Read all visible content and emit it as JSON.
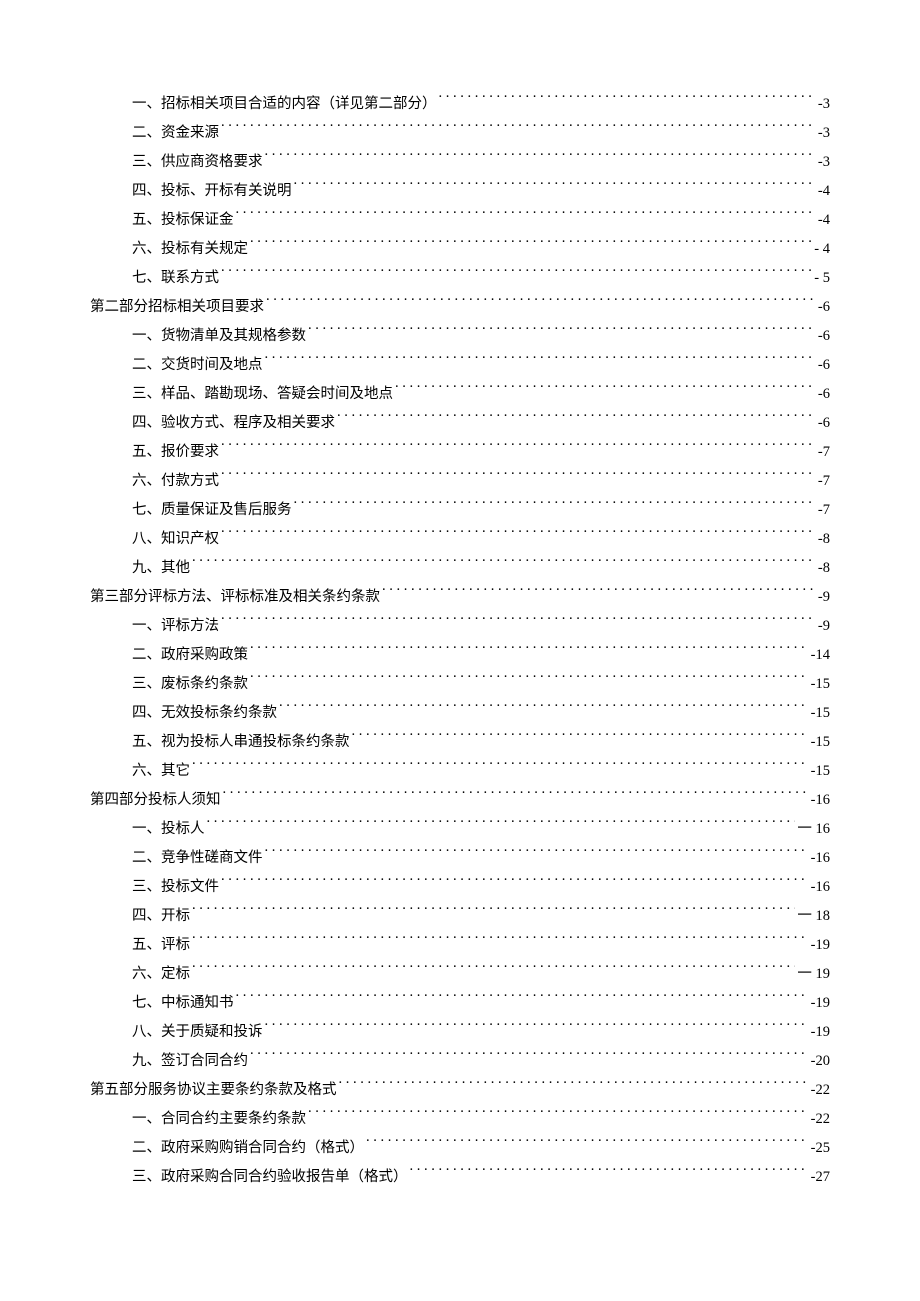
{
  "toc": [
    {
      "level": 2,
      "label": "一、招标相关项目合适的内容（详见第二部分）",
      "page": "-3"
    },
    {
      "level": 2,
      "label": "二、资金来源",
      "page": "-3"
    },
    {
      "level": 2,
      "label": "三、供应商资格要求",
      "page": "-3"
    },
    {
      "level": 2,
      "label": "四、投标、开标有关说明",
      "page": "-4"
    },
    {
      "level": 2,
      "label": "五、投标保证金",
      "page": "-4"
    },
    {
      "level": 2,
      "label": "六、投标有关规定",
      "page": "- 4"
    },
    {
      "level": 2,
      "label": "七、联系方式",
      "page": "- 5"
    },
    {
      "level": 1,
      "label": "第二部分招标相关项目要求",
      "page": "-6"
    },
    {
      "level": 2,
      "label": "一、货物清单及其规格参数",
      "page": "-6"
    },
    {
      "level": 2,
      "label": "二、交货时间及地点",
      "page": "-6"
    },
    {
      "level": 2,
      "label": "三、样品、踏勘现场、答疑会时间及地点",
      "page": "-6"
    },
    {
      "level": 2,
      "label": "四、验收方式、程序及相关要求",
      "page": "-6"
    },
    {
      "level": 2,
      "label": "五、报价要求",
      "page": "-7"
    },
    {
      "level": 2,
      "label": "六、付款方式",
      "page": "-7"
    },
    {
      "level": 2,
      "label": "七、质量保证及售后服务",
      "page": "-7"
    },
    {
      "level": 2,
      "label": "八、知识产权",
      "page": "-8"
    },
    {
      "level": 2,
      "label": "九、其他",
      "page": "-8"
    },
    {
      "level": 1,
      "label": "第三部分评标方法、评标标准及相关条约条款",
      "page": "-9"
    },
    {
      "level": 2,
      "label": "一、评标方法",
      "page": "-9"
    },
    {
      "level": 2,
      "label": "二、政府采购政策",
      "page": "-14"
    },
    {
      "level": 2,
      "label": "三、废标条约条款",
      "page": "-15"
    },
    {
      "level": 2,
      "label": "四、无效投标条约条款",
      "page": "-15"
    },
    {
      "level": 2,
      "label": "五、视为投标人串通投标条约条款",
      "page": "-15"
    },
    {
      "level": 2,
      "label": "六、其它",
      "page": "-15"
    },
    {
      "level": 1,
      "label": "第四部分投标人须知",
      "page": "-16"
    },
    {
      "level": 2,
      "label": "一、投标人",
      "page": "一 16"
    },
    {
      "level": 2,
      "label": "二、竞争性磋商文件",
      "page": "-16"
    },
    {
      "level": 2,
      "label": "三、投标文件",
      "page": "-16"
    },
    {
      "level": 2,
      "label": "四、开标",
      "page": "一 18"
    },
    {
      "level": 2,
      "label": "五、评标",
      "page": "-19"
    },
    {
      "level": 2,
      "label": "六、定标",
      "page": "一 19"
    },
    {
      "level": 2,
      "label": "七、中标通知书",
      "page": "-19"
    },
    {
      "level": 2,
      "label": "八、关于质疑和投诉",
      "page": "-19"
    },
    {
      "level": 2,
      "label": "九、签订合同合约",
      "page": "-20"
    },
    {
      "level": 1,
      "label": "第五部分服务协议主要条约条款及格式",
      "page": "-22"
    },
    {
      "level": 2,
      "label": "一、合同合约主要条约条款",
      "page": "-22"
    },
    {
      "level": 2,
      "label": "二、政府采购购销合同合约（格式）",
      "page": "-25"
    },
    {
      "level": 2,
      "label": "三、政府采购合同合约验收报告单（格式）",
      "page": "-27"
    }
  ]
}
